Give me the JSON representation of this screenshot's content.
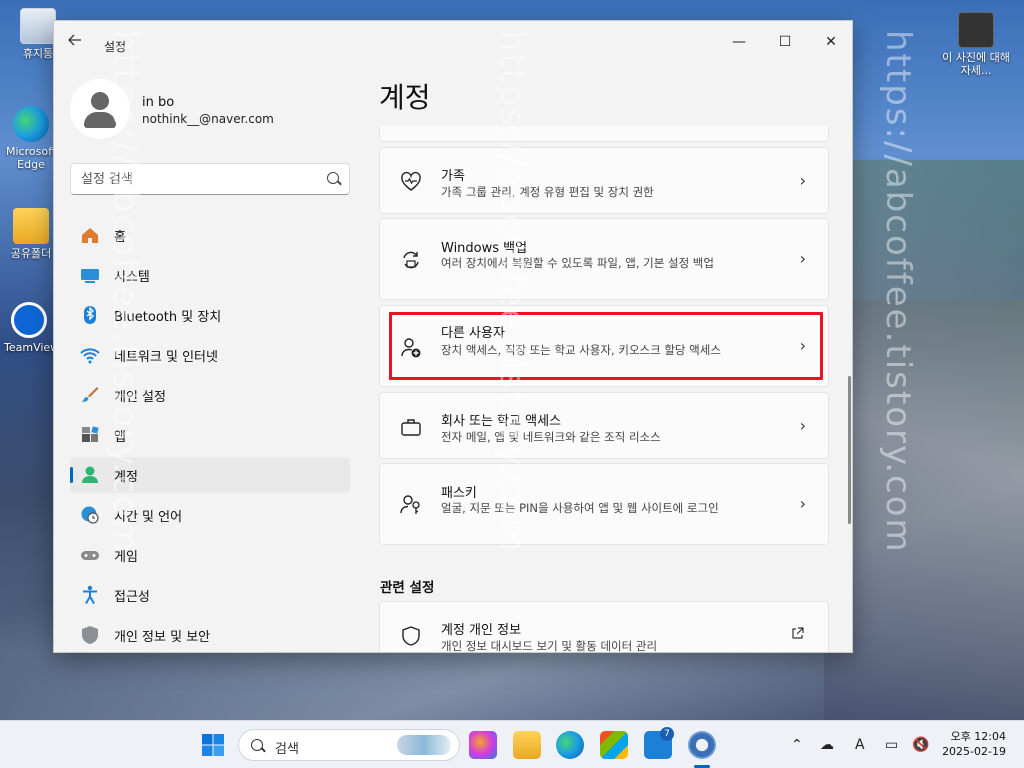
{
  "desktop": {
    "icons": [
      {
        "label": "휴지통"
      },
      {
        "label": "Microsoft Edge"
      },
      {
        "label": "공유폴더"
      },
      {
        "label": "TeamViewer"
      },
      {
        "label": "이 사진에 대해 자세..."
      }
    ]
  },
  "window": {
    "title": "설정",
    "back_icon": "back-arrow-icon",
    "controls": {
      "minimize": "—",
      "maximize": "☐",
      "close": "✕"
    }
  },
  "user": {
    "name": "in bo",
    "email": "nothink__@naver.com"
  },
  "search": {
    "placeholder": "설정 검색"
  },
  "nav": {
    "items": [
      {
        "label": "홈",
        "icon": "home-icon",
        "active": false
      },
      {
        "label": "시스템",
        "icon": "system-icon",
        "active": false
      },
      {
        "label": "Bluetooth 및 장치",
        "icon": "bluetooth-icon",
        "active": false
      },
      {
        "label": "네트워크 및 인터넷",
        "icon": "wifi-icon",
        "active": false
      },
      {
        "label": "개인 설정",
        "icon": "brush-icon",
        "active": false
      },
      {
        "label": "앱",
        "icon": "apps-icon",
        "active": false
      },
      {
        "label": "계정",
        "icon": "account-icon",
        "active": true
      },
      {
        "label": "시간 및 언어",
        "icon": "globe-clock-icon",
        "active": false
      },
      {
        "label": "게임",
        "icon": "gamepad-icon",
        "active": false
      },
      {
        "label": "접근성",
        "icon": "accessibility-icon",
        "active": false
      },
      {
        "label": "개인 정보 및 보안",
        "icon": "shield-icon",
        "active": false
      }
    ]
  },
  "content": {
    "title": "계정",
    "cards": [
      {
        "title": "가족",
        "desc": "가족 그룹 관리, 계정 유형 편집 및 장치 권한",
        "icon": "family-heart-icon"
      },
      {
        "title": "Windows 백업",
        "desc": "여러 장치에서 복원할 수 있도록 파일, 앱, 기본 설정 백업",
        "icon": "backup-icon"
      },
      {
        "title": "다른 사용자",
        "desc": "장치 액세스, 직장 또는 학교 사용자, 키오스크 할당 액세스",
        "icon": "add-user-icon",
        "highlighted": true
      },
      {
        "title": "회사 또는 학교 액세스",
        "desc": "전자 메일, 앱 및 네트워크와 같은 조직 리소스",
        "icon": "briefcase-icon"
      },
      {
        "title": "패스키",
        "desc": "얼굴, 지문 또는 PIN을 사용하여 앱 및 웹 사이트에 로그인",
        "icon": "passkey-icon"
      }
    ],
    "related_section": "관련 설정",
    "related_cards": [
      {
        "title": "계정 개인 정보",
        "desc": "개인 정보 대시보드 보기 및 활동 데이터 관리",
        "icon": "shield-icon",
        "action_icon": "external-link-icon"
      }
    ]
  },
  "taskbar": {
    "search_label": "검색",
    "badge_count": "7",
    "tray": {
      "ime": "A"
    },
    "clock": {
      "time": "오후 12:04",
      "date": "2025-02-19"
    }
  },
  "watermark": "https://abcoffee.tistory.com",
  "colors": {
    "accent": "#0067c0",
    "highlight_box": "#e81224"
  }
}
